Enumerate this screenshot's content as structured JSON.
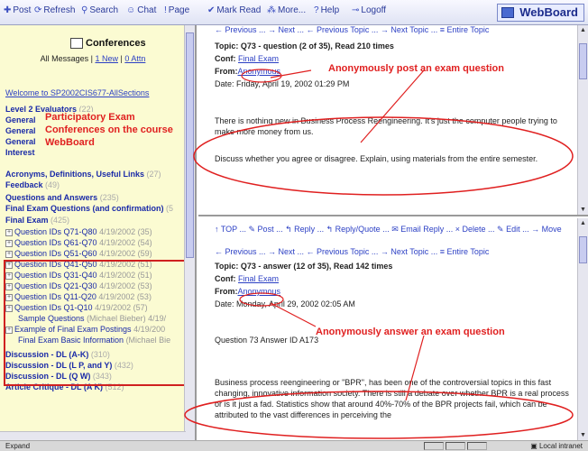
{
  "toolbar": {
    "items": [
      {
        "label": "Post",
        "icon": "post-icon"
      },
      {
        "label": "Refresh",
        "icon": "refresh-icon"
      },
      {
        "label": "Search",
        "icon": "search-icon"
      },
      {
        "label": "Chat",
        "icon": "chat-icon"
      },
      {
        "label": "Page",
        "icon": "page-icon"
      },
      {
        "label": "Mark Read",
        "icon": "mark-read-icon"
      },
      {
        "label": "More...",
        "icon": "more-icon"
      },
      {
        "label": "Help",
        "icon": "help-icon"
      },
      {
        "label": "Logoff",
        "icon": "logoff-icon"
      }
    ],
    "logo": "WebBoard"
  },
  "sidebar": {
    "header": "Conferences",
    "all_messages": "All Messages",
    "new_link": "1 New",
    "attn_link": "0 Attn",
    "welcome": "Welcome to SP2002CIS677-AllSections",
    "items": [
      {
        "label": "Level 2 Evaluators",
        "count": "(22)"
      },
      {
        "label": "General",
        "count": ""
      },
      {
        "label": "General",
        "count": ""
      },
      {
        "label": "General",
        "count": ""
      },
      {
        "label": "Interest",
        "count": ""
      },
      {
        "label": "Acronyms, Definitions, Useful Links",
        "count": "(27)"
      },
      {
        "label": "Feedback",
        "count": "(49)"
      },
      {
        "label": "Questions and Answers",
        "count": "(235)"
      },
      {
        "label": "Final Exam Questions (and confirmation)",
        "count": "(5"
      },
      {
        "label": "Final Exam",
        "count": "(425)"
      }
    ],
    "subitems": [
      {
        "label": "Question IDs Q71-Q80",
        "meta": "4/19/2002 (35)"
      },
      {
        "label": "Question IDs Q61-Q70",
        "meta": "4/19/2002 (54)"
      },
      {
        "label": "Question IDs Q51-Q60",
        "meta": "4/19/2002 (59)"
      },
      {
        "label": "Question IDs Q41-Q50",
        "meta": "4/19/2002 (51)"
      },
      {
        "label": "Question IDs Q31-Q40",
        "meta": "4/19/2002 (51)"
      },
      {
        "label": "Question IDs Q21-Q30",
        "meta": "4/19/2002 (53)"
      },
      {
        "label": "Question IDs Q11-Q20",
        "meta": "4/19/2002 (53)"
      },
      {
        "label": "Question IDs Q1-Q10",
        "meta": "4/19/2002 (57)"
      }
    ],
    "plain_items": [
      {
        "label": "Sample Questions",
        "meta": "(Michael Bieber) 4/19/"
      },
      {
        "label": "Example of Final Exam Postings",
        "meta": "4/19/200"
      },
      {
        "label": "Final Exam Basic Information",
        "meta": "(Michael Bie"
      }
    ],
    "bottom_items": [
      {
        "label": "Discussion - DL (A-K)",
        "count": "(310)"
      },
      {
        "label": "Discussion - DL (L P, and Y)",
        "count": "(432)"
      },
      {
        "label": "Discussion - DL (Q W)",
        "count": "(343)"
      },
      {
        "label": "Article Critique - DL (A K)",
        "count": "(512)"
      }
    ]
  },
  "annotations": {
    "conferences_line1": "Participatory Exam",
    "conferences_line2": "Conferences on the course",
    "conferences_line3": "WebBoard",
    "post_question": "Anonymously post an exam question",
    "answer_question": "Anonymously answer an exam question"
  },
  "msg1": {
    "nav": "← Previous ... → Next ... ← Previous Topic ... → Next Topic ... ≡ Entire Topic",
    "topic": "Topic: Q73 - question (2 of 35), Read 210 times",
    "conf_label": "Conf:",
    "conf_value": "Final Exam",
    "from_label": "From:",
    "from_value": "Anonymous",
    "date": "Date: Friday, April 19, 2002 01:29 PM",
    "body1": "There is nothing new in Business Process Reengineering. It's just the computer people trying to make more money from us.",
    "body2": "Discuss whether you agree or disagree. Explain, using materials from the entire semester."
  },
  "msg2": {
    "actions": "↑ TOP ... ✎ Post ... ↰ Reply ... ↰ Reply/Quote ... ✉ Email Reply ... × Delete ... ✎ Edit ... → Move",
    "nav": "← Previous ... → Next ... ← Previous Topic ... → Next Topic ... ≡ Entire Topic",
    "topic": "Topic: Q73 - answer (12 of 35), Read 142 times",
    "conf_label": "Conf:",
    "conf_value": "Final Exam",
    "from_label": "From:",
    "from_value": "Anonymous",
    "date": "Date: Monday, April 29, 2002 02:05 AM",
    "answer_id": "Question 73 Answer ID A173",
    "body": "Business process reengineering or \"BPR\", has been one of the controversial topics in this fast changing, innovative information society. There is still a debate over whether BPR is a real process or is it just a fad. Statistics show that around 40%-70% of the BPR projects fail, which can be attributed to the vast differences in perceiving the"
  },
  "status": {
    "label": "Expand",
    "zone": "Local intranet"
  },
  "colors": {
    "annotation": "#e02020",
    "sidebar_bg": "#fbfbd2",
    "link": "#2b3fc4"
  }
}
